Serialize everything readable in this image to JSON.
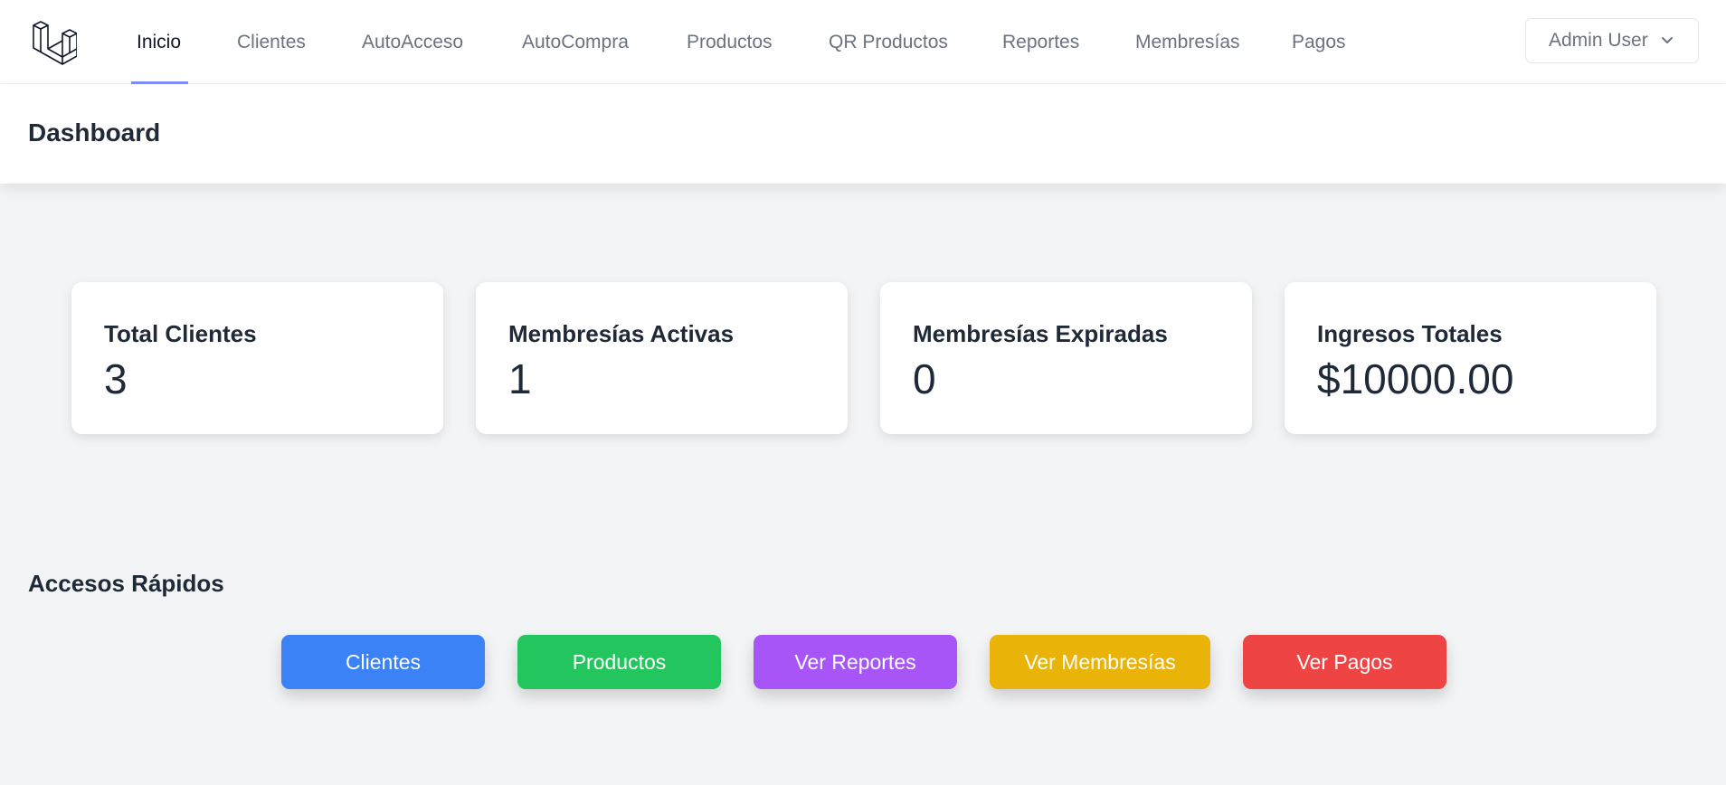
{
  "nav": {
    "logo_icon": "laravel-logo-icon",
    "items": [
      {
        "label": "Inicio",
        "active": true
      },
      {
        "label": "Clientes"
      },
      {
        "label": "AutoAcceso"
      },
      {
        "label": "AutoCompra"
      },
      {
        "label": "Productos"
      },
      {
        "label": "QR Productos"
      },
      {
        "label": "Reportes"
      },
      {
        "label": "Membresías"
      },
      {
        "label": "Pagos"
      }
    ],
    "user": {
      "label": "Admin User",
      "icon": "chevron-down-icon"
    }
  },
  "header": {
    "title": "Dashboard"
  },
  "stats": [
    {
      "label": "Total Clientes",
      "value": "3"
    },
    {
      "label": "Membresías Activas",
      "value": "1"
    },
    {
      "label": "Membresías Expiradas",
      "value": "0"
    },
    {
      "label": "Ingresos Totales",
      "value": "$10000.00"
    }
  ],
  "quick_access": {
    "title": "Accesos Rápidos",
    "buttons": [
      {
        "label": "Clientes",
        "color": "#3b82f6"
      },
      {
        "label": "Productos",
        "color": "#22c55e"
      },
      {
        "label": "Ver Reportes",
        "color": "#a855f7"
      },
      {
        "label": "Ver Membresías",
        "color": "#eab308"
      },
      {
        "label": "Ver Pagos",
        "color": "#ef4444"
      }
    ]
  },
  "colors": {
    "accent": "#818cf8",
    "background": "#f3f4f6"
  }
}
